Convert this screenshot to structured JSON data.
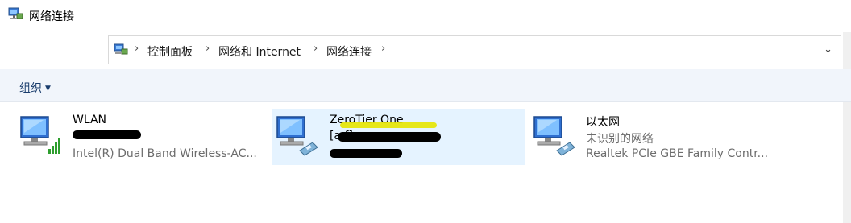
{
  "window": {
    "title": "网络连接"
  },
  "nav": {
    "back_icon": "arrow-left-icon",
    "forward_icon": "arrow-right-icon",
    "recent_icon": "chevron-down-icon",
    "up_icon": "arrow-up-icon"
  },
  "address": {
    "crumbs": [
      "控制面板",
      "网络和 Internet",
      "网络连接"
    ]
  },
  "commandbar": {
    "organize": "组织"
  },
  "adapters": [
    {
      "name": "WLAN",
      "status": "",
      "device": "Intel(R) Dual Band Wireless-AC...",
      "icon": "wifi-adapter-icon"
    },
    {
      "name": "ZeroTier One",
      "status": "[a                    f]",
      "device": "",
      "icon": "ethernet-adapter-icon"
    },
    {
      "name": "以太网",
      "status": "未识别的网络",
      "device": "Realtek PCIe GBE Family Contr...",
      "icon": "ethernet-adapter-icon"
    }
  ],
  "colors": {
    "selection": "#e5f3ff",
    "commandbar": "#f1f5fb",
    "link": "#1a3d6d"
  }
}
